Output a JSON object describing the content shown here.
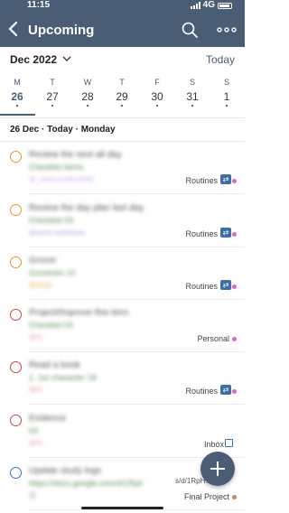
{
  "status_bar": {
    "time": "11:15",
    "network": "4G"
  },
  "header": {
    "title": "Upcoming",
    "back_icon": "chevron-left-icon",
    "search_icon": "search-icon",
    "more_icon": "more-horizontal-icon"
  },
  "calendar": {
    "month_label": "Dec 2022",
    "today_label": "Today",
    "days": [
      {
        "dow": "M",
        "num": "26",
        "selected": true
      },
      {
        "dow": "T",
        "num": "27"
      },
      {
        "dow": "W",
        "num": "28"
      },
      {
        "dow": "T",
        "num": "29"
      },
      {
        "dow": "F",
        "num": "30"
      },
      {
        "dow": "S",
        "num": "31"
      },
      {
        "dow": "S",
        "num": "1"
      }
    ]
  },
  "section_title": "26 Dec · Today · Monday",
  "tasks": [
    {
      "title": "Review the next all day",
      "desc": "Checklist items",
      "label": "@_work productivity",
      "project": "Routines",
      "circle_color": "#e8962d",
      "label_color": "#c9a5e8",
      "project_dot": "#d966d9",
      "project_icon": "repeat-icon"
    },
    {
      "title": "Review the day plan last day",
      "desc": "Checklist 03",
      "label": "@work workdone",
      "project": "Routines",
      "circle_color": "#e8962d",
      "label_color": "#b49ae0",
      "project_dot": "#d966d9",
      "project_icon": "repeat-icon"
    },
    {
      "title": "Grocer",
      "desc": "Groceries 12",
      "label": "@shop",
      "project": "Routines",
      "circle_color": "#e8962d",
      "label_color": "#e8b84a",
      "project_dot": "#d966d9",
      "project_icon": "repeat-icon"
    },
    {
      "title": "Project/Improve this item",
      "desc": "Checklist 04",
      "label": "@hi",
      "project": "Personal",
      "circle_color": "#d93f3f",
      "label_color": "#e89aa8",
      "project_dot": "#d966d9",
      "project_icon": ""
    },
    {
      "title": "Read a book",
      "desc": "1. 1st character 18",
      "label": "@hi",
      "project": "Routines",
      "circle_color": "#d93f3f",
      "label_color": "#e89aa8",
      "project_dot": "#d966d9",
      "project_icon": "repeat-icon"
    },
    {
      "title": "Evidence",
      "desc": "03",
      "label": "@hi",
      "project": "Inbox",
      "circle_color": "#d93f3f",
      "label_color": "#e89aa8",
      "project_dot": "",
      "project_icon": "inbox-icon"
    },
    {
      "title": "Update study logs",
      "desc": "https://docs.google.com/d/1Rph",
      "label": "@",
      "project": "Final Project",
      "circle_color": "#3a6fd9",
      "label_color": "#999999",
      "project_dot": "#c98a5a",
      "project_icon": ""
    }
  ],
  "url_fragment": "s/d/1RpH...",
  "fab_icon": "plus-icon"
}
